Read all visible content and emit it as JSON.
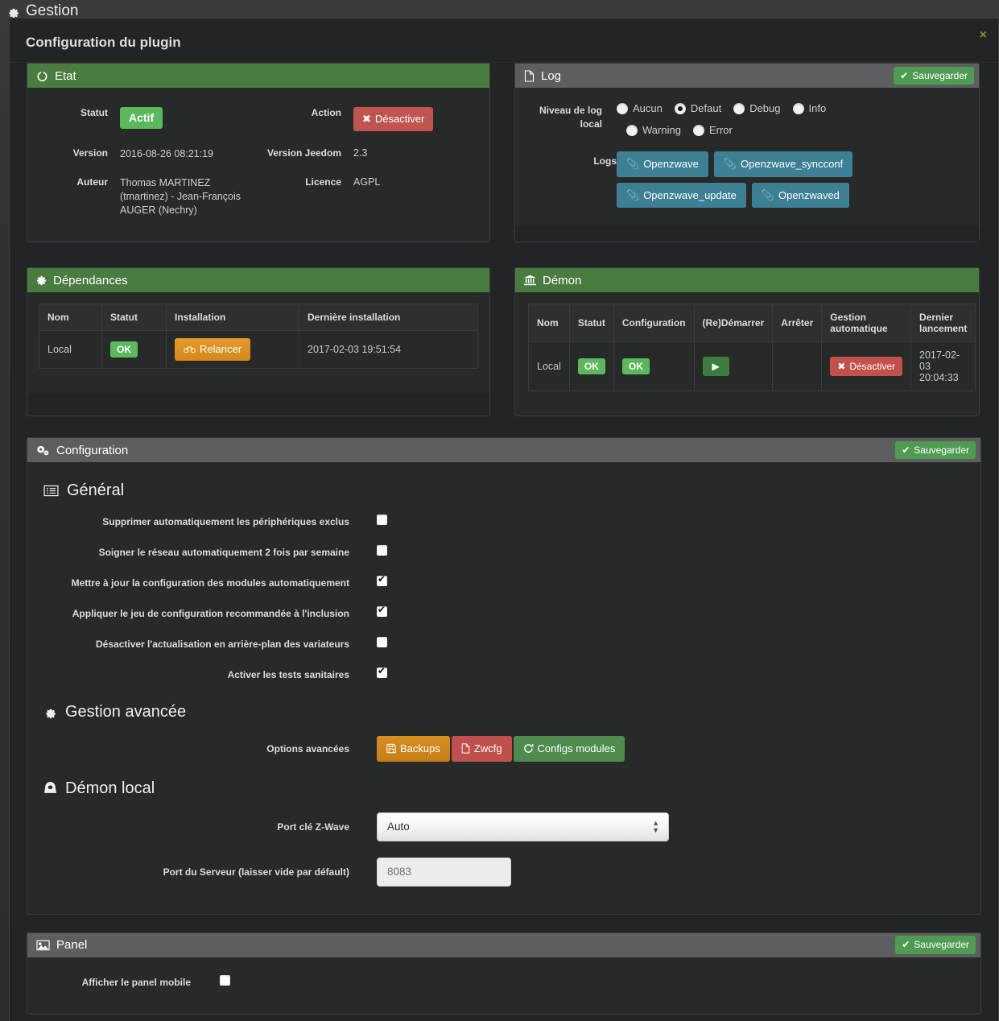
{
  "page": {
    "title": "Gestion",
    "icon": "gear-icon"
  },
  "modal": {
    "title": "Configuration du plugin",
    "close_label": "×"
  },
  "etat": {
    "header": "Etat",
    "header_icon": "power-circle-icon",
    "rows": [
      {
        "label": "Statut",
        "value": "Actif",
        "label2": "Action",
        "value2": "Désactiver"
      },
      {
        "label": "Version",
        "value": "2016-08-26 08:21:19",
        "label2": "Version Jeedom",
        "value2": "2.3"
      },
      {
        "label": "Auteur",
        "value": "Thomas MARTINEZ (tmartinez) - Jean-François AUGER (Nechry)",
        "label2": "Licence",
        "value2": "AGPL"
      }
    ]
  },
  "log": {
    "header": "Log",
    "header_icon": "file-icon",
    "save_label": "Sauvegarder",
    "level_label": "Niveau de log local",
    "levels": [
      {
        "label": "Aucun",
        "selected": false
      },
      {
        "label": "Defaut",
        "selected": true
      },
      {
        "label": "Debug",
        "selected": false
      },
      {
        "label": "Info",
        "selected": false
      },
      {
        "label": "Warning",
        "selected": false
      },
      {
        "label": "Error",
        "selected": false
      }
    ],
    "logs_label": "Logs",
    "log_buttons": [
      "Openzwave",
      "Openzwave_syncconf",
      "Openzwave_update",
      "Openzwaved"
    ]
  },
  "dependances": {
    "header": "Dépendances",
    "header_icon": "asterisk-icon",
    "columns": [
      "Nom",
      "Statut",
      "Installation",
      "Dernière installation"
    ],
    "row": {
      "nom": "Local",
      "statut": "OK",
      "installation_btn": "Relancer",
      "derniere": "2017-02-03 19:51:54"
    }
  },
  "demon": {
    "header": "Démon",
    "header_icon": "bank-icon",
    "columns": [
      "Nom",
      "Statut",
      "Configuration",
      "(Re)Démarrer",
      "Arrêter",
      "Gestion automatique",
      "Dernier lancement"
    ],
    "row": {
      "nom": "Local",
      "statut": "OK",
      "configuration": "OK",
      "restart_icon": "play-icon",
      "arreter": "",
      "gestion_btn": "Désactiver",
      "dernier": "2017-02-03 20:04:33"
    }
  },
  "configuration": {
    "header": "Configuration",
    "header_icon": "gears-icon",
    "save_label": "Sauvegarder",
    "general": {
      "title": "Général",
      "icon": "list-icon",
      "items": [
        {
          "label": "Supprimer automatiquement les périphériques exclus",
          "checked": false
        },
        {
          "label": "Soigner le réseau automatiquement 2 fois par semaine",
          "checked": false
        },
        {
          "label": "Mettre à jour la configuration des modules automatiquement",
          "checked": true
        },
        {
          "label": "Appliquer le jeu de configuration recommandée à l'inclusion",
          "checked": true
        },
        {
          "label": "Désactiver l'actualisation en arrière-plan des variateurs",
          "checked": false
        },
        {
          "label": "Activer les tests sanitaires",
          "checked": true
        }
      ]
    },
    "avancee": {
      "title": "Gestion avancée",
      "icon": "gear-icon",
      "options_label": "Options avancées",
      "buttons": [
        {
          "label": "Backups",
          "icon": "save-icon",
          "color": "#d78f22"
        },
        {
          "label": "Zwcfg",
          "icon": "file-icon",
          "color": "#c0504d"
        },
        {
          "label": "Configs modules",
          "icon": "refresh-icon",
          "color": "#4f8b4f"
        }
      ]
    },
    "demon_local": {
      "title": "Démon local",
      "icon": "helmet-icon",
      "port_label": "Port clé Z-Wave",
      "port_value": "Auto",
      "port_options": [
        "Auto"
      ],
      "server_label": "Port du Serveur (laisser vide par défault)",
      "server_value": "",
      "server_placeholder": "8083"
    }
  },
  "panel": {
    "header": "Panel",
    "header_icon": "image-icon",
    "save_label": "Sauvegarder",
    "mobile_label": "Afficher le panel mobile",
    "mobile_checked": false
  },
  "colors": {
    "green_header": "#4a7c40",
    "grey_header": "#5d5e5f",
    "save_green": "#4f9b52",
    "danger_red": "#bf5450",
    "info_blue": "#3d7f94",
    "warn_orange": "#d78f22",
    "ok_green": "#5cb85c",
    "close_olive": "#8a8f3a",
    "background": "#2f3031"
  }
}
